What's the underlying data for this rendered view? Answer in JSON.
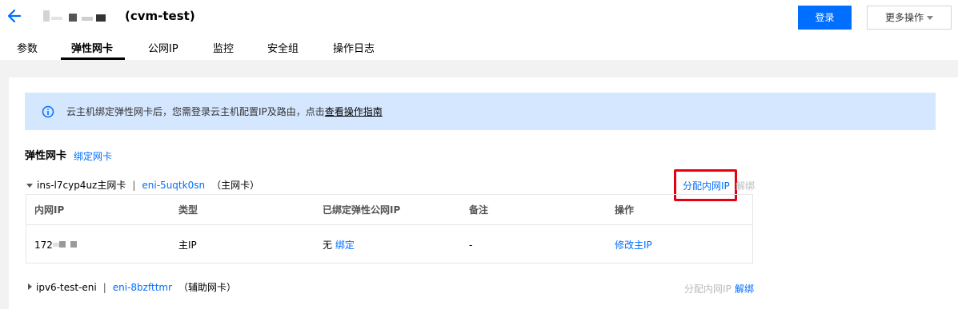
{
  "header": {
    "title": "(cvm-test)",
    "login_label": "登录",
    "more_label": "更多操作"
  },
  "tabs": [
    {
      "label": "参数"
    },
    {
      "label": "弹性网卡"
    },
    {
      "label": "公网IP"
    },
    {
      "label": "监控"
    },
    {
      "label": "安全组"
    },
    {
      "label": "操作日志"
    }
  ],
  "notice": {
    "text": "云主机绑定弹性网卡后，您需登录云主机配置IP及路由，点击",
    "link": "查看操作指南"
  },
  "section": {
    "title": "弹性网卡",
    "bind_label": "绑定网卡"
  },
  "eni_primary": {
    "instance": "ins-l7cyp4uz主网卡",
    "eni_id": "eni-5uqtk0sn",
    "role": "（主网卡）",
    "alloc_label": "分配内网IP",
    "unbind_label": "解绑"
  },
  "table": {
    "headers": [
      "内网IP",
      "类型",
      "已绑定弹性公网IP",
      "备注",
      "操作"
    ],
    "rows": [
      {
        "ip_prefix": "172",
        "type": "主IP",
        "eip_none": "无",
        "eip_bind": "绑定",
        "remark": "-",
        "action": "修改主IP"
      }
    ]
  },
  "eni_secondary": {
    "name": "ipv6-test-eni",
    "eni_id": "eni-8bzfttmr",
    "role": "（辅助网卡）",
    "alloc_label": "分配内网IP",
    "unbind_label": "解绑"
  },
  "colors": {
    "accent": "#006eff",
    "notice_bg": "#d5e7ff",
    "highlight": "#e60012"
  }
}
